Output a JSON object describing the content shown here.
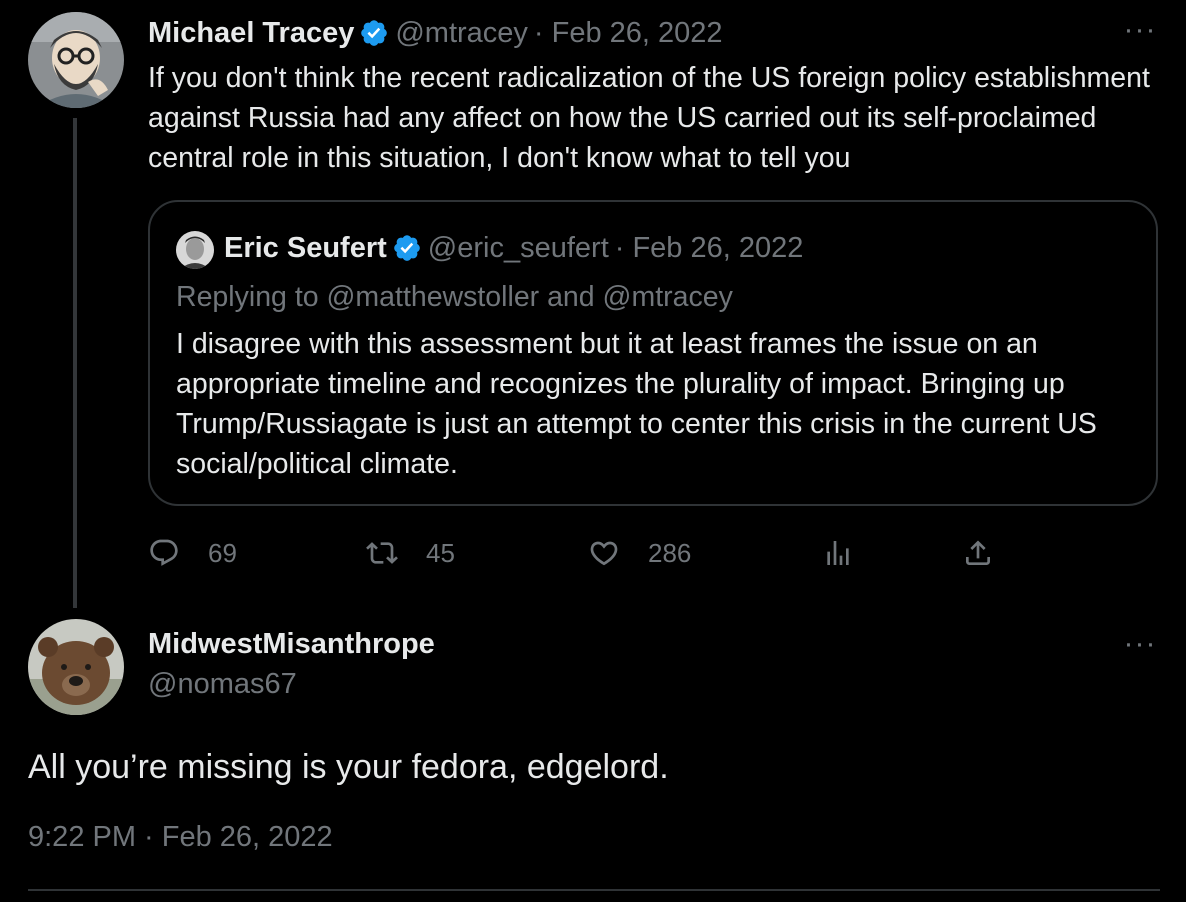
{
  "colors": {
    "background": "#000000",
    "text_primary": "#e7e9ea",
    "text_secondary": "#71767b",
    "verified_badge": "#1d9bf0",
    "border": "#2f3336"
  },
  "tweet1": {
    "author_name": "Michael Tracey",
    "verified": true,
    "handle": "@mtracey",
    "date": "· Feb 26, 2022",
    "more_icon": "more-horizontal-icon",
    "text": "If you don't think the recent radicalization of the US foreign policy establishment against Russia had any affect on how the US carried out its self-proclaimed central role in this situation, I don't know what to tell you",
    "quoted": {
      "author_name": "Eric Seufert",
      "verified": true,
      "handle": "@eric_seufert",
      "date": "· Feb 26, 2022",
      "replying_to": "Replying to @matthewstoller and @mtracey",
      "text": "I disagree with this assessment but it at least frames the issue on an appropriate timeline and recognizes the plurality of impact. Bringing up Trump/Russiagate is just an attempt to center this crisis in the current US social/political climate."
    },
    "actions": {
      "replies": "69",
      "retweets": "45",
      "likes": "286",
      "views_icon": "analytics-icon",
      "share_icon": "share-icon"
    }
  },
  "tweet2": {
    "author_name": "MidwestMisanthrope",
    "handle": "@nomas67",
    "more_icon": "more-horizontal-icon",
    "text": "All you’re missing is your fedora, edgelord.",
    "timestamp": "9:22 PM · Feb 26, 2022"
  }
}
